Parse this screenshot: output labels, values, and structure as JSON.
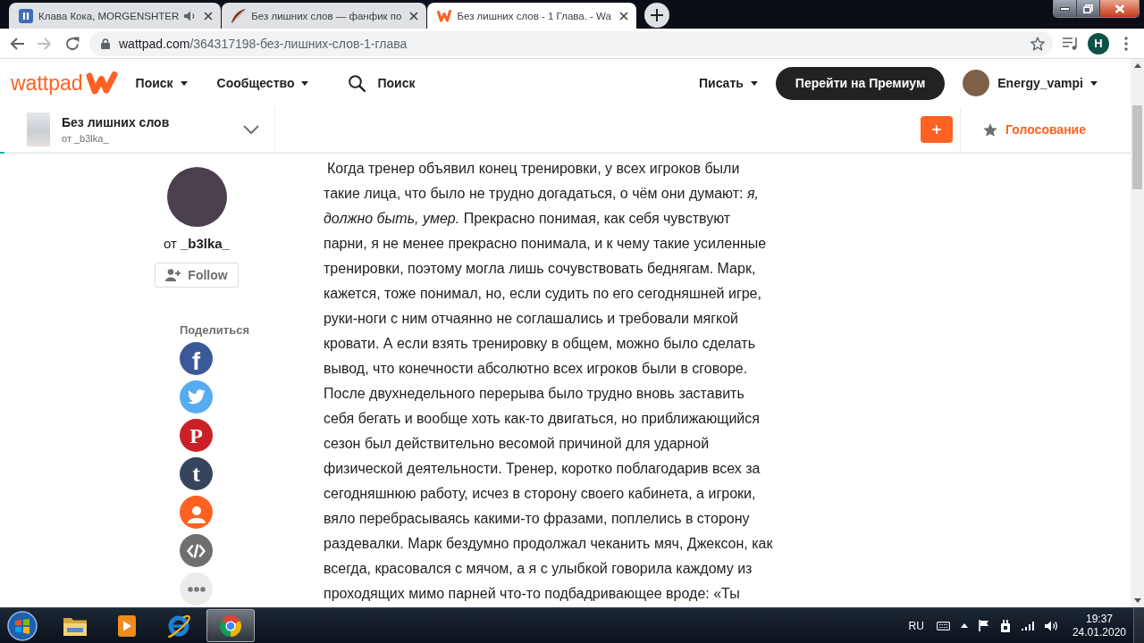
{
  "browser": {
    "tabs": [
      {
        "title": "Клава Кока, MORGENSHTER",
        "kind": "player",
        "audio": true,
        "selected": false
      },
      {
        "title": "Без лишних слов — фанфик по",
        "kind": "quill",
        "audio": false,
        "selected": false
      },
      {
        "title": "Без лишних слов - 1 Глава. - Wa",
        "kind": "wattpad",
        "audio": false,
        "selected": true
      }
    ],
    "address": {
      "host": "wattpad.com",
      "path": "/364317198-без-лишних-слов-1-глава"
    },
    "profile": {
      "initial": "H"
    }
  },
  "header": {
    "logo": "wattpad",
    "nav": [
      {
        "label": "Поиск"
      },
      {
        "label": "Сообщество"
      }
    ],
    "search": {
      "placeholder": "Поиск"
    },
    "write": {
      "label": "Писать"
    },
    "premium": {
      "label": "Перейти на Премиум"
    },
    "user": {
      "name": "Energy_vampi"
    }
  },
  "story": {
    "title": "Без лишних слов",
    "author": "от _b3lka_",
    "add": "+",
    "vote": "Голосование",
    "progress": {
      "level": 0.004
    }
  },
  "author": {
    "by": "от",
    "name": "_b3lka_",
    "follow": "Follow"
  },
  "share": {
    "label": "Поделиться",
    "items": [
      {
        "kind": "facebook",
        "glyph": "f"
      },
      {
        "kind": "twitter"
      },
      {
        "kind": "pinterest",
        "glyph": "P"
      },
      {
        "kind": "tumblr",
        "glyph": "t"
      },
      {
        "kind": "profile"
      },
      {
        "kind": "embed"
      },
      {
        "kind": "more"
      }
    ]
  },
  "chapter": {
    "text": "Когда тренер объявил конец тренировки, у всех игроков были такие лица, что было не трудно догадаться, о чём они думают: *я, должно быть, умер.* Прекрасно понимая, как себя чувствуют парни, я не менее прекрасно понимала, и к чему такие усиленные тренировки, поэтому могла лишь сочувствовать беднягам. Марк, кажется, тоже понимал, но, если судить по его сегодняшней игре, руки-ноги с ним отчаянно не соглашались и требовали мягкой кровати. А если взять тренировку в общем, можно было сделать вывод, что конечности абсолютно всех игроков были в сговоре. После двухнедельного перерыва было трудно вновь заставить себя бегать и вообще хоть как-то двигаться, но приближающийся сезон был действительно весомой причиной для ударной физической деятельности. Тренер, коротко поблагодарив всех за сегодняшнюю работу, исчез в сторону своего кабинета, а игроки, вяло перебрасываясь какими-то фразами, поплелись в сторону раздевалки. Марк бездумно продолжал чеканить мяч, Джексон, как всегда, красовался с мячом, а я с улыбкой говорила каждому из проходящих мимо парней что-то подбадривающее вроде: «Ты"
  },
  "taskbar": {
    "apps": [
      {
        "kind": "explorer",
        "selected": false
      },
      {
        "kind": "player",
        "selected": false
      },
      {
        "kind": "ie",
        "selected": false
      },
      {
        "kind": "chrome",
        "selected": true
      }
    ],
    "tray": {
      "language": "RU",
      "time": "19:37",
      "date": "24.01.2020"
    }
  }
}
